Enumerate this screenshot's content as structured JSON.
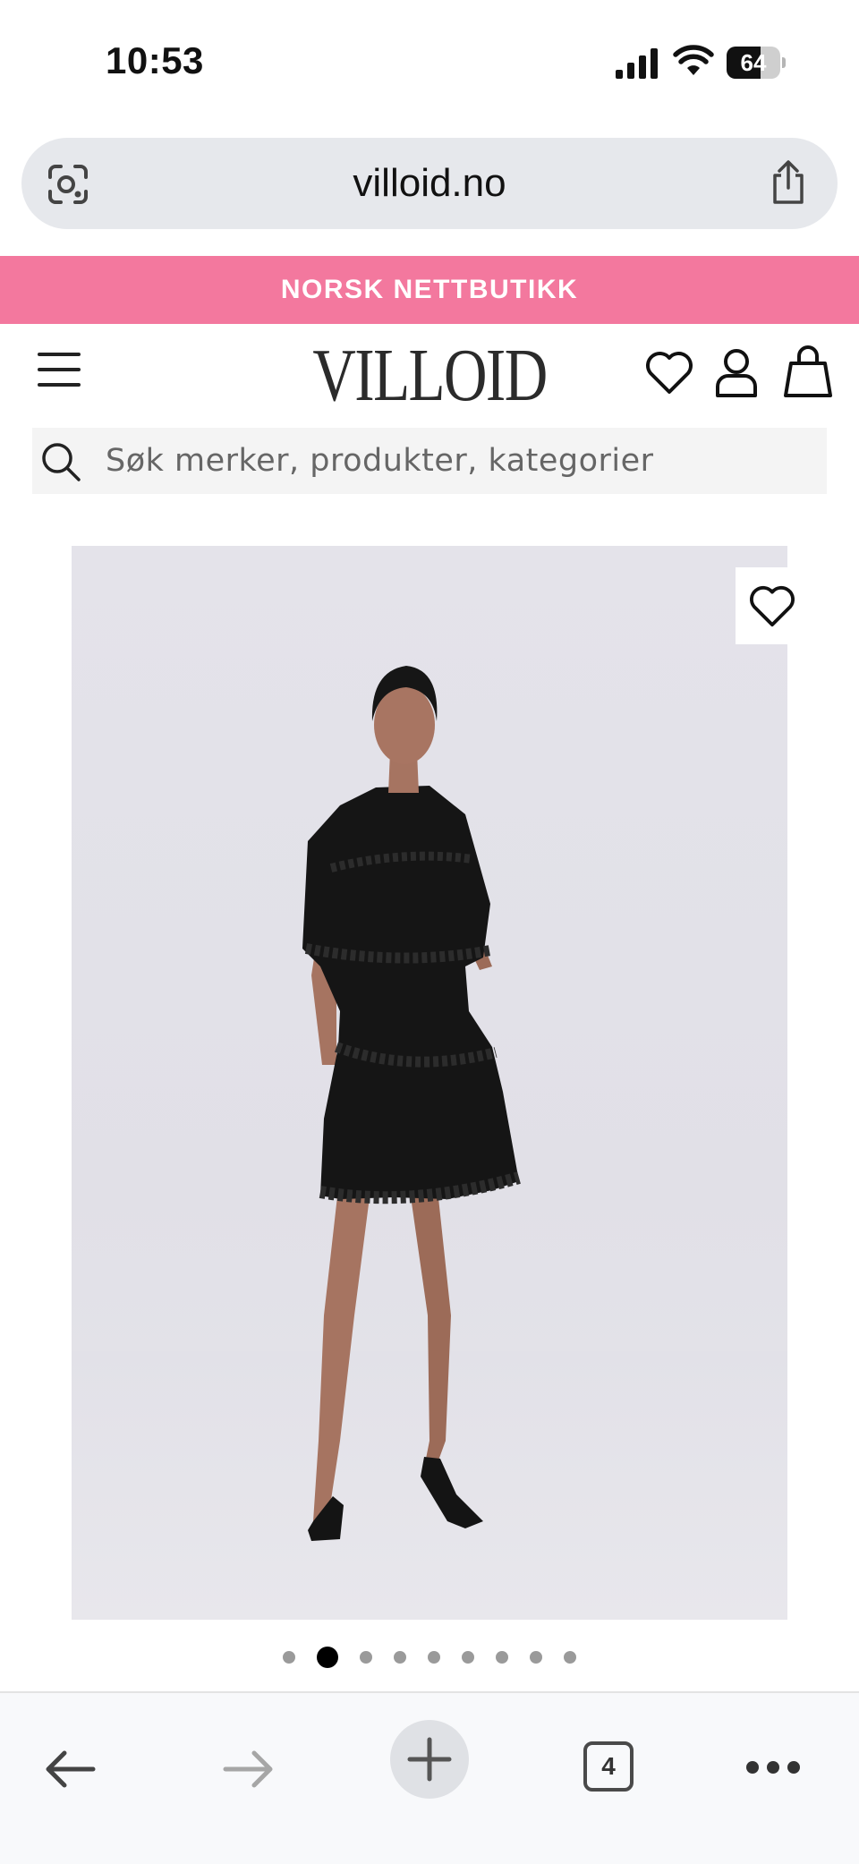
{
  "status_bar": {
    "time": "10:53",
    "battery_percent": 64,
    "battery_label": "64",
    "icons": [
      "signal-icon",
      "wifi-icon",
      "battery-icon"
    ]
  },
  "browser": {
    "url": "villoid.no",
    "icons": [
      "google-lens-icon",
      "share-icon"
    ]
  },
  "banner": {
    "text": "NORSK NETTBUTIKK",
    "color": "#f3789e"
  },
  "header": {
    "logo": "VILLOID",
    "icons": [
      "menu-icon",
      "heart-icon",
      "user-icon",
      "shopping-bag-icon"
    ]
  },
  "search": {
    "placeholder": "Søk merker, produkter, kategorier",
    "icon": "search-icon"
  },
  "product": {
    "image_alt": "Model wearing a black tiered ruffle dress with black heels",
    "favorite_icon": "heart-icon"
  },
  "carousel": {
    "total_images": 9,
    "current_index": 2
  },
  "toolbar": {
    "tab_count": "4",
    "icons": [
      "back-arrow-icon",
      "forward-arrow-icon",
      "plus-icon",
      "tabs-icon",
      "more-icon"
    ]
  }
}
